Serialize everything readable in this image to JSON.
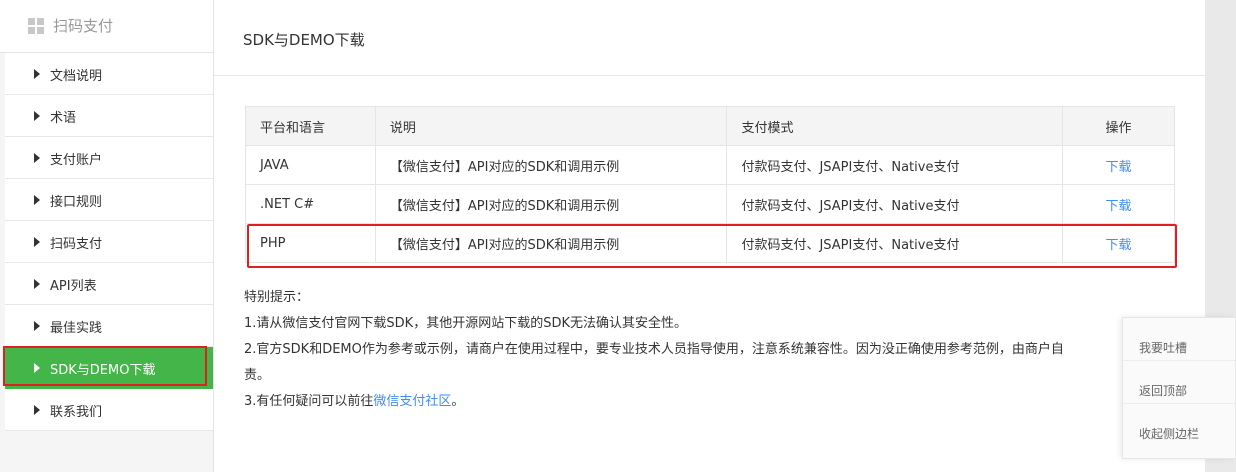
{
  "sidebar": {
    "title": "扫码支付",
    "items": [
      {
        "label": "文档说明"
      },
      {
        "label": "术语"
      },
      {
        "label": "支付账户"
      },
      {
        "label": "接口规则"
      },
      {
        "label": "扫码支付"
      },
      {
        "label": "API列表"
      },
      {
        "label": "最佳实践"
      },
      {
        "label": "SDK与DEMO下载",
        "active": true
      },
      {
        "label": "联系我们"
      }
    ]
  },
  "main": {
    "title": "SDK与DEMO下载",
    "table": {
      "headers": [
        "平台和语言",
        "说明",
        "支付模式",
        "操作"
      ],
      "rows": [
        [
          "JAVA",
          "【微信支付】API对应的SDK和调用示例",
          "付款码支付、JSAPI支付、Native支付",
          "下载"
        ],
        [
          ".NET C#",
          "【微信支付】API对应的SDK和调用示例",
          "付款码支付、JSAPI支付、Native支付",
          "下载"
        ],
        [
          "PHP",
          "【微信支付】API对应的SDK和调用示例",
          "付款码支付、JSAPI支付、Native支付",
          "下载"
        ]
      ]
    },
    "notes": {
      "heading": "特别提示：",
      "line1": "1.请从微信支付官网下载SDK，其他开源网站下载的SDK无法确认其安全性。",
      "line2": "2.官方SDK和DEMO作为参考或示例，请商户在使用过程中，要专业技术人员指导使用，注意系统兼容性。因为没正确使用参考范例，由商户自",
      "line2b": "责。",
      "line3_prefix": "3.有任何疑问可以前往",
      "line3_link": "微信支付社区",
      "line3_suffix": "。"
    }
  },
  "float_panel": {
    "items": [
      "我要吐槽",
      "返回顶部",
      "收起侧边栏"
    ]
  },
  "colors": {
    "accent_green": "#44b549",
    "link_blue": "#3e8ef7",
    "highlight_red": "#e02020"
  }
}
